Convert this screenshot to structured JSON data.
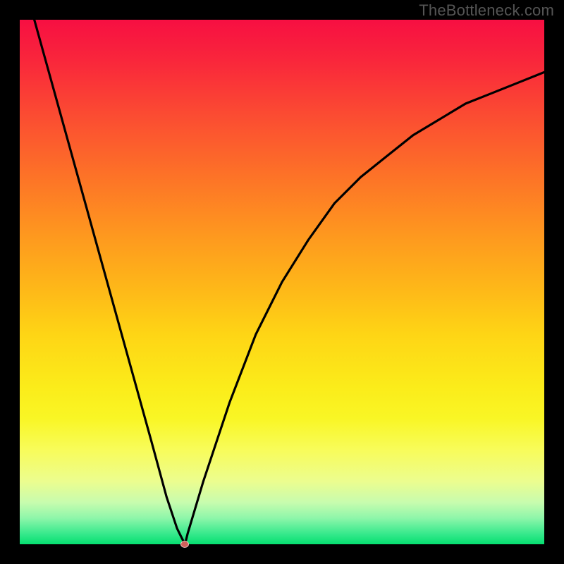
{
  "watermark": "TheBottleneck.com",
  "chart_data": {
    "type": "line",
    "title": "",
    "xlabel": "",
    "ylabel": "",
    "xlim": [
      0,
      100
    ],
    "ylim": [
      0,
      100
    ],
    "background_gradient": {
      "top": "#f70f42",
      "mid": "#fed515",
      "bottom": "#05df70"
    },
    "series": [
      {
        "name": "curve",
        "x": [
          0,
          5,
          10,
          15,
          20,
          25,
          28,
          30,
          31,
          31.5,
          32,
          35,
          40,
          45,
          50,
          55,
          60,
          65,
          70,
          75,
          80,
          85,
          90,
          95,
          100
        ],
        "values": [
          110,
          92,
          74,
          56,
          38,
          20,
          9,
          3,
          1,
          0,
          2,
          12,
          27,
          40,
          50,
          58,
          65,
          70,
          74,
          78,
          81,
          84,
          86,
          88,
          90
        ],
        "stroke": "#000000"
      }
    ],
    "marker": {
      "x": 31.5,
      "y": 0,
      "color": "#d0615b"
    }
  }
}
